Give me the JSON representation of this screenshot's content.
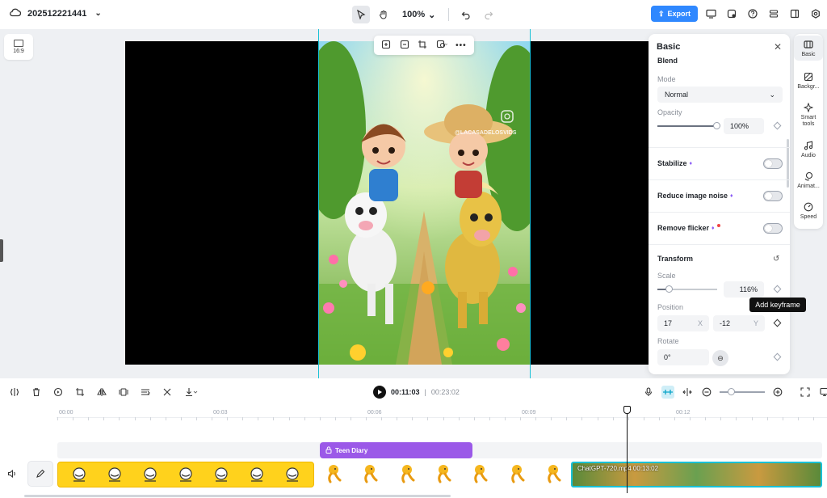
{
  "header": {
    "project_name": "202512221441",
    "zoom": "100%",
    "export_label": "Export"
  },
  "canvas": {
    "ratio_label": "16:9",
    "video_caption": "@LACASADELOSVIDS"
  },
  "panel": {
    "title": "Basic",
    "blend_label": "Blend",
    "mode_label": "Mode",
    "mode_value": "Normal",
    "opacity_label": "Opacity",
    "opacity_value": "100%",
    "opacity_level": 1.0,
    "stabilize_label": "Stabilize",
    "reduce_noise_label": "Reduce image noise",
    "remove_flicker_label": "Remove flicker",
    "transform_label": "Transform",
    "scale_label": "Scale",
    "scale_value": "116%",
    "position_label": "Position",
    "position_x": "17",
    "position_x_axis": "X",
    "position_y": "-12",
    "position_y_axis": "Y",
    "rotate_label": "Rotate",
    "rotate_value": "0°",
    "tooltip": "Add keyframe"
  },
  "rail": {
    "items": [
      {
        "label": "Basic"
      },
      {
        "label": "Backgr..."
      },
      {
        "label": "Smart tools"
      },
      {
        "label": "Audio"
      },
      {
        "label": "Animat..."
      },
      {
        "label": "Speed"
      }
    ]
  },
  "timeline": {
    "current_time": "00:11:03",
    "separator": "|",
    "duration": "00:23:02",
    "ruler": [
      "00:00",
      "00:03",
      "00:06",
      "00:09",
      "00:12"
    ],
    "text_clip": "Teen Diary",
    "video_clip_label": "ChatGPT-720.mp4  00:13:02"
  },
  "colors": {
    "accent": "#2f88ff",
    "guide": "#18c1d6",
    "text_clip": "#9b59e8",
    "clip_yellow": "#ffd21c"
  }
}
